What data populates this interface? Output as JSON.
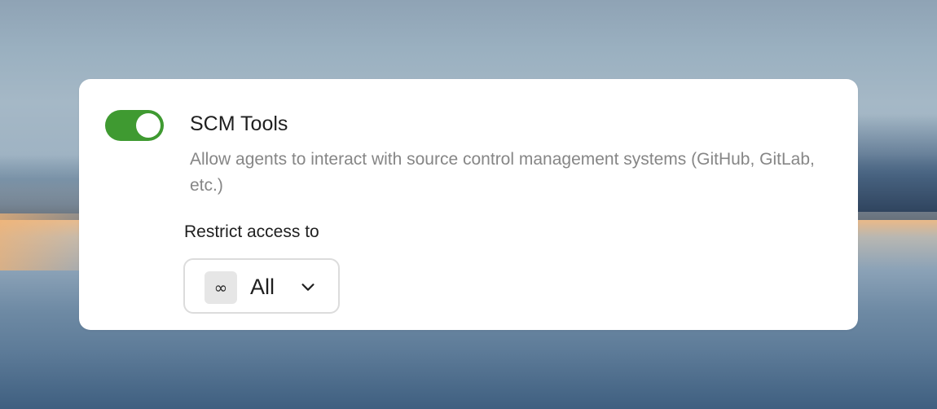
{
  "card": {
    "toggle": {
      "state": "on",
      "color": "#3f9a31"
    },
    "title": "SCM Tools",
    "description": "Allow agents to interact with source control management systems (GitHub, GitLab, etc.)",
    "restrict_label": "Restrict access to",
    "select": {
      "icon_glyph": "∞",
      "icon_name": "infinity-icon",
      "selected_value": "All",
      "chevron_icon": "chevron-down-icon"
    }
  }
}
